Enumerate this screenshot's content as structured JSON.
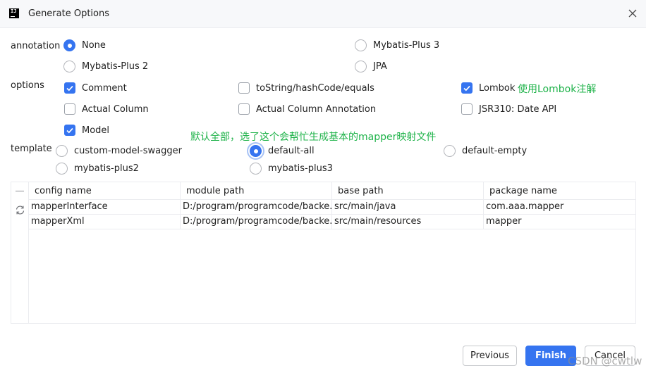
{
  "window": {
    "title": "Generate Options"
  },
  "annotation": {
    "label": "annotation",
    "options": [
      {
        "label": "None",
        "selected": true
      },
      {
        "label": "Mybatis-Plus 3",
        "selected": false
      },
      {
        "label": "Mybatis-Plus 2",
        "selected": false
      },
      {
        "label": "JPA",
        "selected": false
      }
    ]
  },
  "options": {
    "label": "options",
    "items": [
      {
        "label": "Comment",
        "checked": true
      },
      {
        "label": "toString/hashCode/equals",
        "checked": false
      },
      {
        "label": "Lombok",
        "checked": true
      },
      {
        "label": "Actual Column",
        "checked": false
      },
      {
        "label": "Actual Column Annotation",
        "checked": false
      },
      {
        "label": "JSR310: Date API",
        "checked": false
      },
      {
        "label": "Model",
        "checked": true
      }
    ]
  },
  "annotations": {
    "lombok_note": "使用Lombok注解",
    "template_note": "默认全部，选了这个会帮忙生成基本的mapper映射文件"
  },
  "template": {
    "label": "template",
    "options": [
      {
        "label": "custom-model-swagger",
        "selected": false
      },
      {
        "label": "default-all",
        "selected": true
      },
      {
        "label": "default-empty",
        "selected": false
      },
      {
        "label": "mybatis-plus2",
        "selected": false
      },
      {
        "label": "mybatis-plus3",
        "selected": false
      }
    ]
  },
  "table": {
    "columns": [
      "config name",
      "module path",
      "base path",
      "package name"
    ],
    "rows": [
      [
        "mapperInterface",
        "D:/program/programcode/backe...",
        "src/main/java",
        "com.aaa.mapper"
      ],
      [
        "mapperXml",
        "D:/program/programcode/backe...",
        "src/main/resources",
        "mapper"
      ]
    ]
  },
  "buttons": {
    "previous": "Previous",
    "finish": "Finish",
    "cancel": "Cancel"
  },
  "watermark": "CSDN @cwtlw",
  "colors": {
    "accent": "#3574f0",
    "note": "#1fb34a"
  },
  "icons": {
    "app": "intellij-logo-icon",
    "close": "close-icon",
    "refresh": "refresh-icon",
    "minus": "minus-icon"
  }
}
